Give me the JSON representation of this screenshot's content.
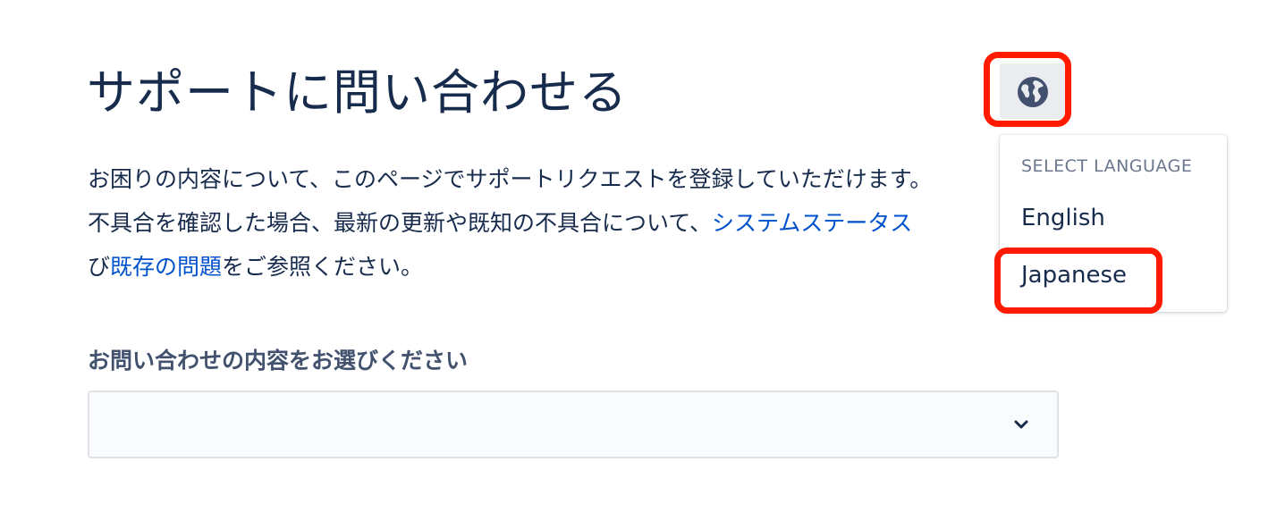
{
  "page": {
    "title": "サポートに問い合わせる",
    "description_line1": "お困りの内容について、このページでサポートリクエストを登録していただけます。",
    "description_line2_text": "不具合を確認した場合、最新の更新や既知の不具合について、",
    "description_line2_link": "システムステータス",
    "description_line3_prefix": "び",
    "description_line3_link": "既存の問題",
    "description_line3_suffix": "をご参照ください。"
  },
  "form": {
    "field_label": "お問い合わせの内容をお選びください",
    "select_value": "",
    "chevron_icon": "chevron-down-icon"
  },
  "language": {
    "globe_icon": "globe-icon",
    "menu_heading": "SELECT LANGUAGE",
    "options": [
      "English",
      "Japanese"
    ]
  },
  "colors": {
    "text": "#172b4d",
    "link": "#0052cc",
    "highlight": "#ff1a00",
    "muted": "#6b778c"
  }
}
